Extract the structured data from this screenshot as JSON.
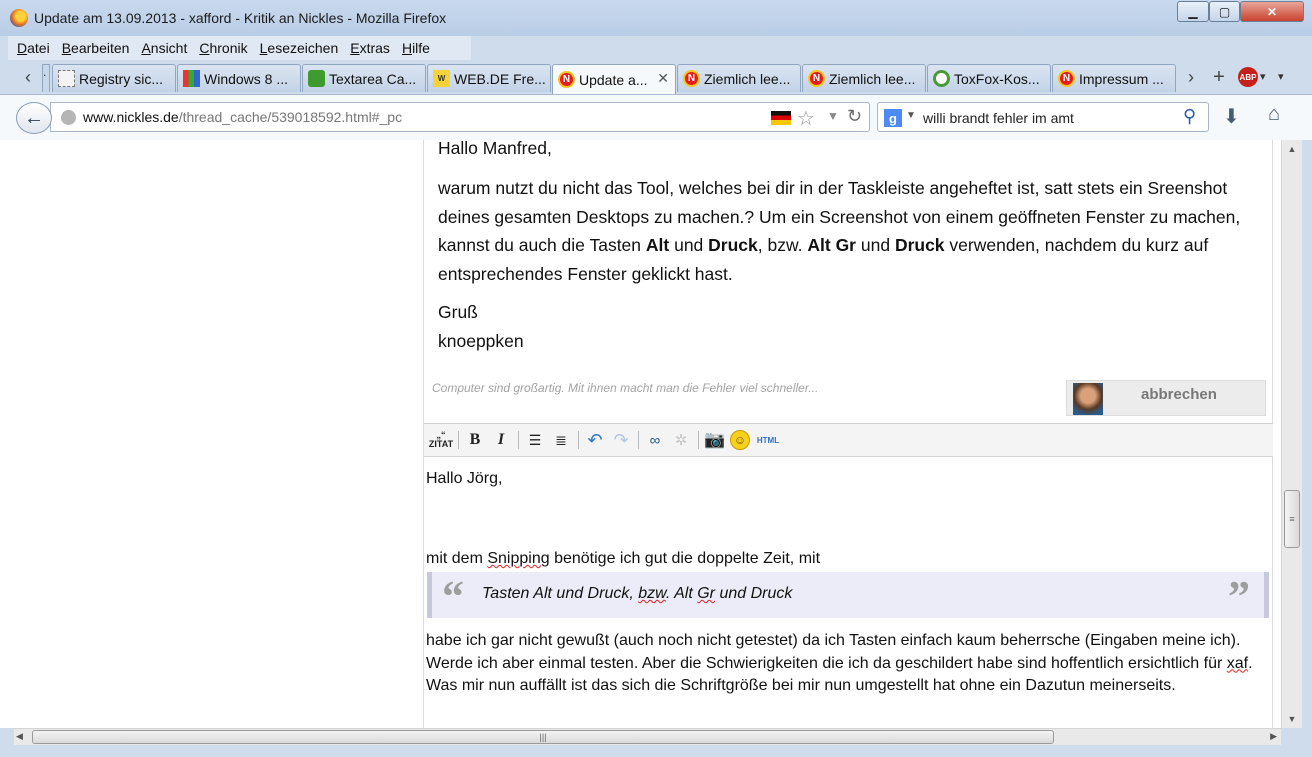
{
  "window": {
    "title": "Update am 13.09.2013 - xafford - Kritik an Nickles - Mozilla Firefox",
    "controls": {
      "minimize": "▁",
      "maximize": "▢",
      "close": "✕"
    }
  },
  "menu": [
    "Datei",
    "Bearbeiten",
    "Ansicht",
    "Chronik",
    "Lesezeichen",
    "Extras",
    "Hilfe"
  ],
  "tabs": [
    {
      "label": "Registry sic...",
      "icon": "dashed-page-icon"
    },
    {
      "label": "Windows 8 ...",
      "icon": "grid-icon"
    },
    {
      "label": "Textarea Ca...",
      "icon": "puzzle-icon"
    },
    {
      "label": "WEB.DE Fre...",
      "icon": "webde-icon"
    },
    {
      "label": "Update a...",
      "icon": "nickles-icon",
      "active": true
    },
    {
      "label": "Ziemlich lee...",
      "icon": "nickles-icon"
    },
    {
      "label": "Ziemlich lee...",
      "icon": "nickles-icon"
    },
    {
      "label": "ToxFox-Kos...",
      "icon": "toxfox-icon"
    },
    {
      "label": "Impressum ...",
      "icon": "nickles-icon"
    }
  ],
  "tab_cut_label": ".",
  "nav": {
    "url_domain": "www.nickles.de",
    "url_path": "/thread_cache/539018592.html#_pc",
    "search_value": "willi brandt fehler im amt"
  },
  "post": {
    "greeting": "Hallo Manfred,",
    "body_parts": [
      "warum nutzt du nicht das Tool, welches bei dir in der Taskleiste angeheftet ist, satt stets ein Sreenshot deines gesamten Desktops zu machen.? Um ein Screenshot von einem geöffneten Fenster zu machen, kannst du auch die Tasten ",
      "Alt",
      " und ",
      "Druck",
      ", bzw. ",
      "Alt Gr",
      " und ",
      "Druck",
      " verwenden, nachdem du kurz auf entsprechendes Fenster geklickt hast."
    ],
    "sign_line1": "Gruß",
    "sign_line2": "knoeppken",
    "signature": "Computer sind großartig. Mit ihnen macht man die Fehler viel schneller...",
    "cancel_label": "abbrechen"
  },
  "editor": {
    "toolbar": {
      "quote_label": "ZITAT",
      "bold": "B",
      "italic": "I",
      "html": "HTML"
    },
    "greeting": "Hallo Jörg,",
    "line2_parts": [
      "mit dem ",
      "Snipping",
      " benötige ich gut die doppelte Zeit, mit"
    ],
    "quote_parts": [
      "Tasten Alt und Druck, ",
      "bzw",
      ". Alt ",
      "Gr",
      " und Druck"
    ],
    "body_parts": [
      "habe ich gar nicht gewußt (auch noch nicht getestet) da ich Tasten einfach kaum beherrsche (Eingaben meine ich). Werde ich aber einmal testen. Aber die Schwierigkeiten die ich da geschildert habe sind hoffentlich ersichtlich für ",
      "xaf",
      ". Was mir nun auffällt ist das sich die Schriftgröße bei mir nun umgestellt hat ohne ein Dazutun meinerseits."
    ]
  }
}
